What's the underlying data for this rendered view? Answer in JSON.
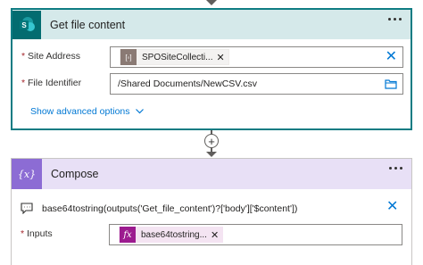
{
  "flow": {
    "steps": [
      {
        "title": "Get file content",
        "icon": "sharepoint-icon",
        "accent": "#036c70",
        "fields": [
          {
            "label": "Site Address",
            "required": "*",
            "token_text": "SPOSiteCollecti...",
            "token_icon": "dynamic-content-icon"
          },
          {
            "label": "File Identifier",
            "required": "*",
            "value": "/Shared Documents/NewCSV.csv"
          }
        ],
        "advanced_label": "Show advanced options"
      },
      {
        "title": "Compose",
        "icon": "compose-icon",
        "accent": "#8c6cd4",
        "comment": "base64tostring(outputs('Get_file_content')?['body']['$content'])",
        "fields": [
          {
            "label": "Inputs",
            "required": "*",
            "token_text": "base64tostring(...)",
            "token_icon": "fx-icon"
          }
        ]
      }
    ],
    "compose_token_display": "base64tostring..."
  },
  "icons": {
    "fx": "fx",
    "compose_glyph": "{x}",
    "sp_letter": "S",
    "token_grid": "[◦]"
  },
  "colors": {
    "sp_header": "#d5e9ea",
    "compose_header": "#e8e0f6",
    "link": "#0078d4",
    "fx_token": "#9c1b8f"
  }
}
